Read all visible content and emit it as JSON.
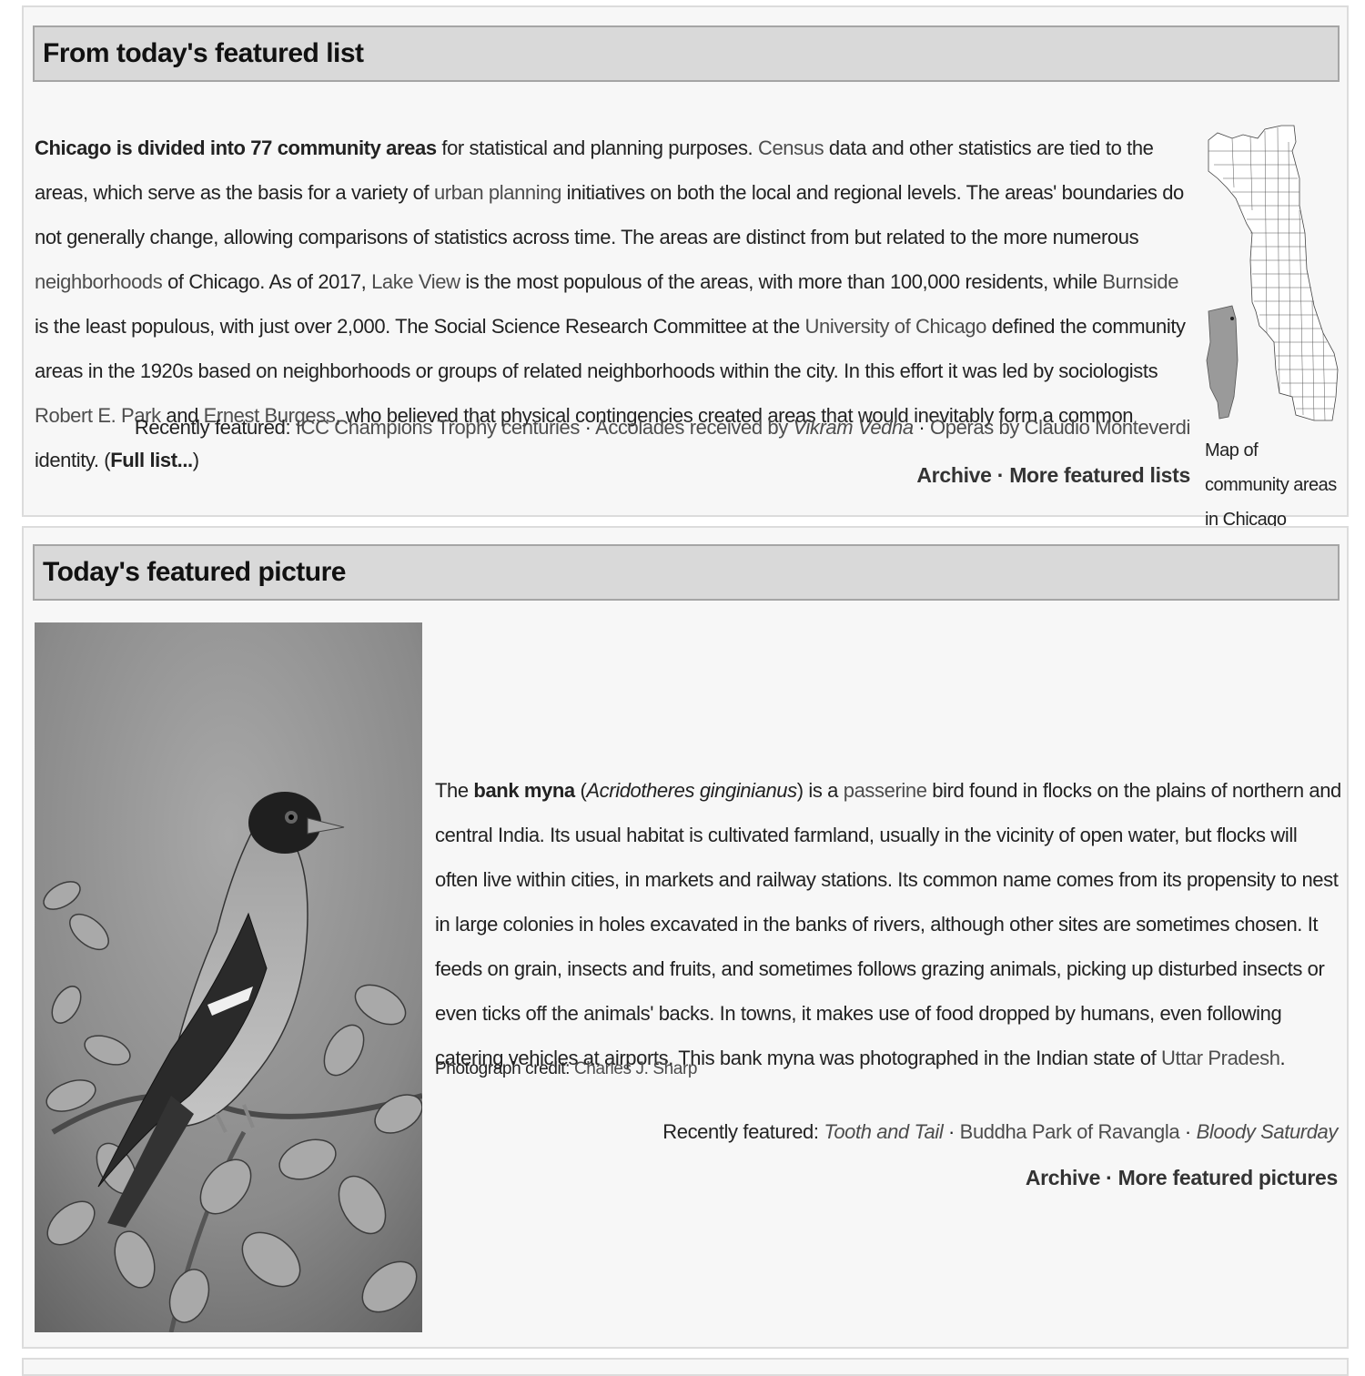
{
  "featured_list": {
    "heading": "From today's featured list",
    "p": {
      "t1_bold": "Chicago is divided into 77 community areas",
      "t2": " for statistical and planning purposes. ",
      "l_census": "Census",
      "t3": " data and other statistics are tied to the areas, which serve as the basis for a variety of ",
      "l_urban": "urban planning",
      "t4": " initiatives on both the local and regional levels. The areas' boundaries do not generally change, allowing comparisons of statistics across time. The areas are distinct from but related to the more numerous ",
      "l_neigh": "neighborhoods",
      "t5": " of Chicago. As of 2017, ",
      "l_lakeview": "Lake View",
      "t6": " is the most populous of the areas, with more than 100,000 residents, while ",
      "l_burnside": "Burnside",
      "t7": " is the least populous, with just over 2,000. The Social Science Research Committee at the ",
      "l_uchicago": "University of Chicago",
      "t8": " defined the community areas in the 1920s based on neighborhoods or groups of related neighborhoods within the city. In this effort it was led by sociologists ",
      "l_park": "Robert E. Park",
      "t9": " and ",
      "l_burgess": "Ernest Burgess",
      "t10": ", who believed that physical contingencies created areas that would inevitably form a common identity. (",
      "l_full": "Full list...",
      "t11": ")"
    },
    "recent": {
      "label": "Recently featured: ",
      "l1": "ICC Champions Trophy centuries",
      "sep": " · ",
      "l2_pre": "Accolades received by ",
      "l2_ital": "Vikram Vedha",
      "l3": "Operas by Claudio Monteverdi"
    },
    "links": {
      "archive": "Archive",
      "sep": " · ",
      "more": "More featured lists"
    },
    "map_caption": "Map of community areas in Chicago"
  },
  "featured_picture": {
    "heading": "Today's featured picture",
    "p": {
      "t1": "The ",
      "b1": "bank myna",
      "t2": " (",
      "i1": "Acridotheres ginginianus",
      "t3": ") is a ",
      "l_passerine": "passerine",
      "t4": " bird found in flocks on the plains of northern and central India. Its usual habitat is cultivated farmland, usually in the vicinity of open water, but flocks will often live within cities, in markets and railway stations. Its common name comes from its propensity to nest in large colonies in holes excavated in the banks of rivers, although other sites are sometimes chosen. It feeds on grain, insects and fruits, and sometimes follows grazing animals, picking up disturbed insects or even ticks off the animals' backs. In towns, it makes use of food dropped by humans, even following catering vehicles at airports. This bank myna was photographed in the Indian state of ",
      "l_uttar": "Uttar Pradesh",
      "t5": "."
    },
    "credit": {
      "label": "Photograph credit: ",
      "name": "Charles J. Sharp"
    },
    "recent": {
      "label": "Recently featured: ",
      "i1": "Tooth and Tail",
      "sep": " · ",
      "l2": "Buddha Park of Ravangla",
      "i3": "Bloody Saturday"
    },
    "links": {
      "archive": "Archive",
      "sep": " · ",
      "more": "More featured pictures"
    }
  },
  "colors": {
    "link": "#4d4d4d",
    "header_bg": "#d9d9d9",
    "box_bg": "#f7f7f7"
  },
  "icons": {
    "map": "chicago-community-areas-map",
    "photo": "bank-myna-photo"
  }
}
